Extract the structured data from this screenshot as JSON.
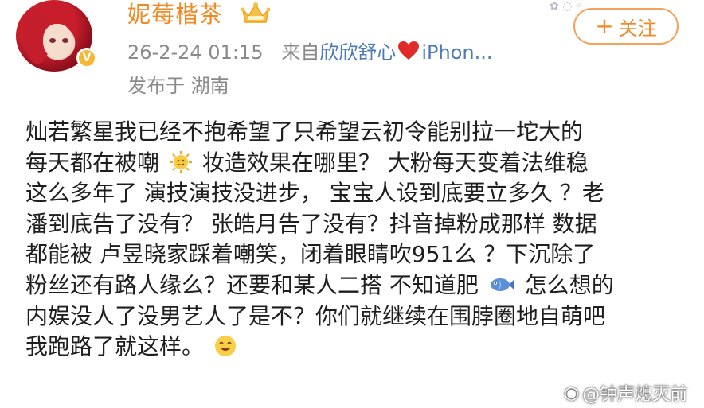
{
  "header": {
    "username": "妮莓楷茶",
    "timestamp": "26-2-24 01:15",
    "source_prefix": "来自",
    "source_name": "欣欣舒心",
    "source_device": "iPhon...",
    "location": "发布于 湖南",
    "follow_label": "关注",
    "follow_plus": "+"
  },
  "colors": {
    "username": "#f08a24",
    "meta": "#8a8a8a",
    "source": "#4c7ab8",
    "follow_border": "#f4a35a"
  },
  "icons": {
    "crown": "crown-icon",
    "verified": "verified-badge-icon",
    "heart": "heart-icon",
    "sun_emoji": "sun-emoji-icon",
    "fish_emoji": "fish-emoji-icon",
    "grin_emoji": "grinning-face-emoji-icon"
  },
  "post": {
    "line1": "灿若繁星我已经不抱希望了只希望云初令能别拉一坨大的",
    "line2a": "每天都在被嘲",
    "line2b": "妆造效果在哪里？ 大粉每天变着法维稳",
    "line3": "这么多年了 演技演技没进步， 宝宝人设到底要立多久 ？老",
    "line4": "潘到底告了没有？ 张皓月告了没有？抖音掉粉成那样 数据",
    "line5": "都能被 卢昱晓家踩着嘲笑，闭着眼睛吹951么 ？下沉除了",
    "line6a": "粉丝还有路人缘么？还要和某人二搭 不知道肥",
    "line6b": "怎么想的",
    "line7": "内娱没人了没男艺人了是不？你们就继续在围脖圈地自萌吧",
    "line8": "我跑路了就这样。"
  },
  "watermark": {
    "text": "@钟声熄灭前"
  }
}
